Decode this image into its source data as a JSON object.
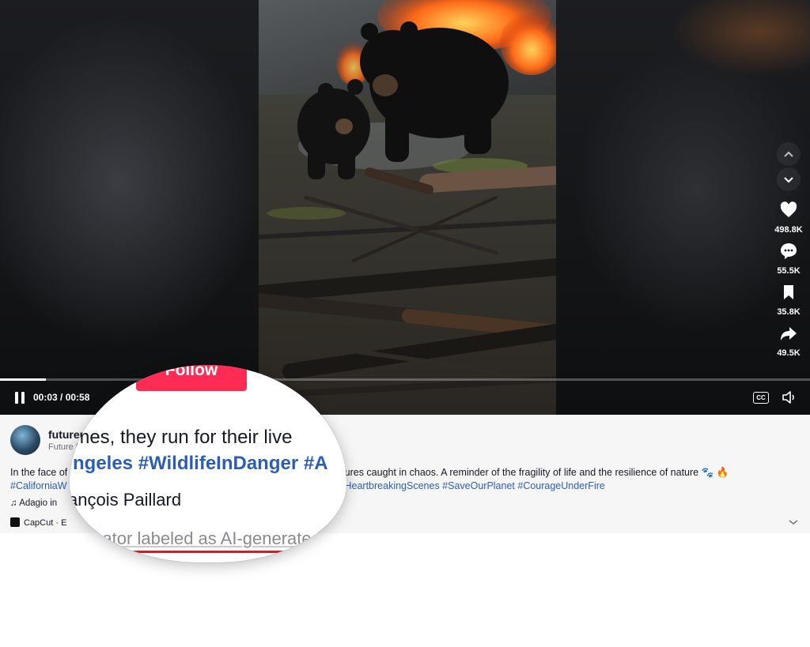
{
  "player": {
    "time": "00:03 / 00:58",
    "progress": 0.057,
    "cc_label": "CC"
  },
  "actions": {
    "likes": "498.8K",
    "comments": "55.5K",
    "saves": "35.8K",
    "shares": "49.5K"
  },
  "creator": {
    "username": "futurer",
    "subname": "Future F"
  },
  "description": {
    "line1_start": "In the face of",
    "line1_end": "eatures caught in chaos. A reminder of the fragility of life and the resilience of nature 🐾 🔥",
    "line2_start_tag": "#CaliforniaW",
    "line2_tags": "#HeartbreakingScenes #SaveOurPlanet #CourageUnderFire"
  },
  "music": "Adagio in",
  "capcut": "CapCut · E",
  "magnifier": {
    "follow_label": "Follow",
    "line1": "imes, they run for their live",
    "line2": "ngeles #WildlifeInDanger #A",
    "line3": "ançois Paillard",
    "ai_label": "Creator labeled as AI-generated"
  },
  "icons": [
    "pause-icon",
    "cc-icon",
    "volume-icon",
    "chevron-up-icon",
    "chevron-down-icon",
    "heart-icon",
    "comment-icon",
    "bookmark-icon",
    "share-icon",
    "music-note-icon",
    "capcut-icon"
  ],
  "colors": {
    "accent": "#fe2c55",
    "hashtag": "#2b5db9",
    "ai_underline": "#e3161b"
  }
}
